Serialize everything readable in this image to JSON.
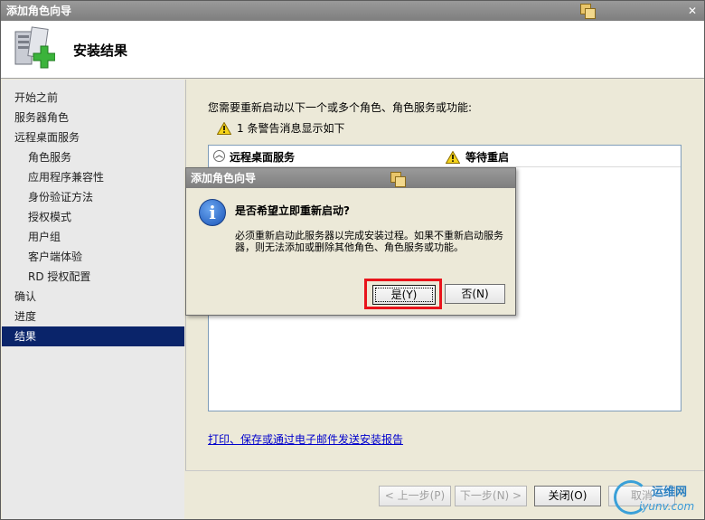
{
  "window": {
    "title": "添加角色向导"
  },
  "header": {
    "title": "安装结果"
  },
  "sidebar": {
    "items": [
      {
        "label": "开始之前"
      },
      {
        "label": "服务器角色"
      },
      {
        "label": "远程桌面服务"
      },
      {
        "label": "角色服务"
      },
      {
        "label": "应用程序兼容性"
      },
      {
        "label": "身份验证方法"
      },
      {
        "label": "授权模式"
      },
      {
        "label": "用户组"
      },
      {
        "label": "客户端体验"
      },
      {
        "label": "RD 授权配置"
      },
      {
        "label": "确认"
      },
      {
        "label": "进度"
      },
      {
        "label": "结果"
      }
    ],
    "active_item": "结果"
  },
  "main": {
    "intro": "您需要重新启动以下一个或多个角色、角色服务或功能:",
    "warning_summary": "1 条警告消息显示如下",
    "results": {
      "role": "远程桌面服务",
      "status": "等待重启"
    },
    "report_link": "打印、保存或通过电子邮件发送安装报告"
  },
  "footer": {
    "prev_label": "< 上一步(P)",
    "next_label": "下一步(N) >",
    "close_label": "关闭(O)",
    "cancel_label": "取消"
  },
  "dialog": {
    "title": "添加角色向导",
    "question": "是否希望立即重新启动?",
    "body": "必须重新启动此服务器以完成安装过程。如果不重新启动服务器，则无法添加或删除其他角色、角色服务或功能。",
    "yes_label": "是(Y)",
    "no_label": "否(N)"
  },
  "watermark": {
    "cn": "运维网",
    "en": "iyunv.com"
  },
  "colors": {
    "selection": "#0a246a",
    "highlight_border": "#e8141b",
    "link": "#0000cc"
  }
}
